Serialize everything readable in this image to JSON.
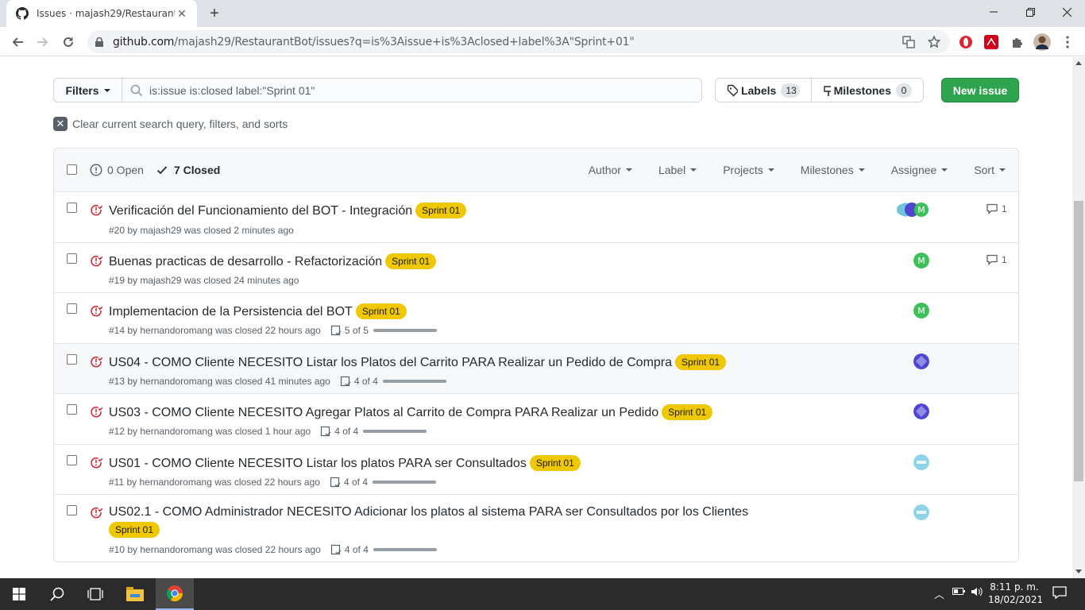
{
  "browser": {
    "tab_title": "Issues · majash29/RestaurantBot",
    "url_host": "github.com",
    "url_path": "/majash29/RestaurantBot/issues?q=is%3Aissue+is%3Aclosed+label%3A\"Sprint+01\""
  },
  "toolbar": {
    "filters_label": "Filters",
    "search_value": "is:issue is:closed label:\"Sprint 01\"",
    "labels_label": "Labels",
    "labels_count": "13",
    "milestones_label": "Milestones",
    "milestones_count": "0",
    "new_issue_label": "New issue",
    "clear_label": "Clear current search query, filters, and sorts"
  },
  "list_header": {
    "open_label": "0 Open",
    "closed_label": "7 Closed",
    "filters": [
      "Author",
      "Label",
      "Projects",
      "Milestones",
      "Assignee",
      "Sort"
    ]
  },
  "issues": [
    {
      "title": "Verificación del Funcionamiento del BOT - Integración",
      "label": "Sprint 01",
      "meta": "#20 by majash29 was closed 2 minutes ago",
      "tasks": "",
      "comments": "1"
    },
    {
      "title": "Buenas practicas de desarrollo - Refactorización",
      "label": "Sprint 01",
      "meta": "#19 by majash29 was closed 24 minutes ago",
      "tasks": "",
      "comments": "1"
    },
    {
      "title": "Implementacion de la Persistencia del BOT",
      "label": "Sprint 01",
      "meta": "#14 by hernandoromang was closed 22 hours ago",
      "tasks": "5 of 5",
      "comments": ""
    },
    {
      "title": "US04 - COMO Cliente NECESITO Listar los Platos del Carrito PARA Realizar un Pedido de Compra",
      "label": "Sprint 01",
      "meta": "#13 by hernandoromang was closed 41 minutes ago",
      "tasks": "4 of 4",
      "comments": ""
    },
    {
      "title": "US03 - COMO Cliente NECESITO Agregar Platos al Carrito de Compra PARA Realizar un Pedido",
      "label": "Sprint 01",
      "meta": "#12 by hernandoromang was closed 1 hour ago",
      "tasks": "4 of 4",
      "comments": ""
    },
    {
      "title": "US01 - COMO Cliente NECESITO Listar los platos PARA ser Consultados",
      "label": "Sprint 01",
      "meta": "#11 by hernandoromang was closed 22 hours ago",
      "tasks": "4 of 4",
      "comments": ""
    },
    {
      "title": "US02.1 - COMO Administrador NECESITO Adicionar los platos al sistema PARA ser Consultados por los Clientes",
      "label": "Sprint 01",
      "meta": "#10 by hernandoromang was closed 22 hours ago",
      "tasks": "4 of 4",
      "comments": ""
    }
  ],
  "taskbar": {
    "time": "8:11 p. m.",
    "date": "18/02/2021"
  },
  "colors": {
    "label_sprint": "#f0c800",
    "closed_icon": "#cb2431",
    "new_issue_bg": "#2ea44f"
  }
}
